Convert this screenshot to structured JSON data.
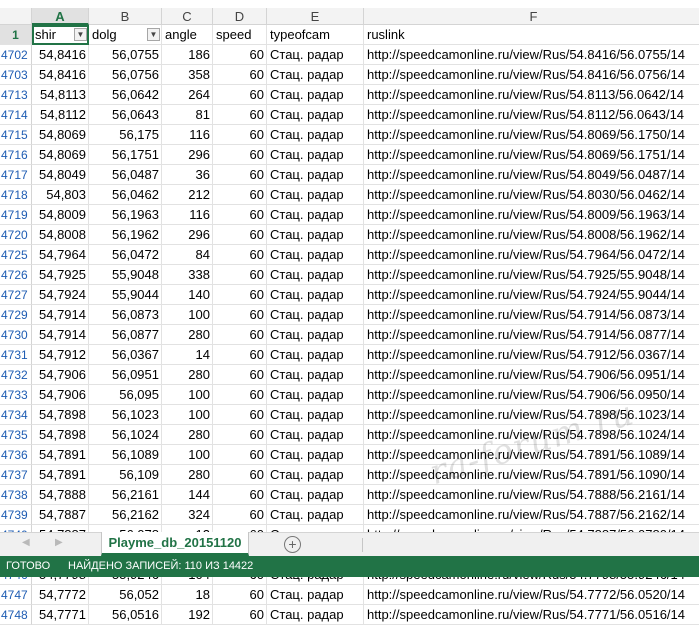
{
  "columns": [
    {
      "letter": "A",
      "selected": true
    },
    {
      "letter": "B",
      "selected": false
    },
    {
      "letter": "C",
      "selected": false
    },
    {
      "letter": "D",
      "selected": false
    },
    {
      "letter": "E",
      "selected": false
    },
    {
      "letter": "F",
      "selected": false
    }
  ],
  "header_row": {
    "row_number": "1",
    "cells": [
      "shir",
      "dolg",
      "angle",
      "speed",
      "typeofcam",
      "ruslink"
    ],
    "filter_icons": [
      "filter-active-icon",
      "filter-dropdown-icon"
    ]
  },
  "rows": [
    {
      "n": "4702",
      "cells": [
        "54,8416",
        "56,0755",
        "186",
        "60",
        "Стац. радар",
        "http://speedcamonline.ru/view/Rus/54.8416/56.0755/14"
      ]
    },
    {
      "n": "4703",
      "cells": [
        "54,8416",
        "56,0756",
        "358",
        "60",
        "Стац. радар",
        "http://speedcamonline.ru/view/Rus/54.8416/56.0756/14"
      ]
    },
    {
      "n": "4713",
      "cells": [
        "54,8113",
        "56,0642",
        "264",
        "60",
        "Стац. радар",
        "http://speedcamonline.ru/view/Rus/54.8113/56.0642/14"
      ]
    },
    {
      "n": "4714",
      "cells": [
        "54,8112",
        "56,0643",
        "81",
        "60",
        "Стац. радар",
        "http://speedcamonline.ru/view/Rus/54.8112/56.0643/14"
      ]
    },
    {
      "n": "4715",
      "cells": [
        "54,8069",
        "56,175",
        "116",
        "60",
        "Стац. радар",
        "http://speedcamonline.ru/view/Rus/54.8069/56.1750/14"
      ]
    },
    {
      "n": "4716",
      "cells": [
        "54,8069",
        "56,1751",
        "296",
        "60",
        "Стац. радар",
        "http://speedcamonline.ru/view/Rus/54.8069/56.1751/14"
      ]
    },
    {
      "n": "4717",
      "cells": [
        "54,8049",
        "56,0487",
        "36",
        "60",
        "Стац. радар",
        "http://speedcamonline.ru/view/Rus/54.8049/56.0487/14"
      ]
    },
    {
      "n": "4718",
      "cells": [
        "54,803",
        "56,0462",
        "212",
        "60",
        "Стац. радар",
        "http://speedcamonline.ru/view/Rus/54.8030/56.0462/14"
      ]
    },
    {
      "n": "4719",
      "cells": [
        "54,8009",
        "56,1963",
        "116",
        "60",
        "Стац. радар",
        "http://speedcamonline.ru/view/Rus/54.8009/56.1963/14"
      ]
    },
    {
      "n": "4720",
      "cells": [
        "54,8008",
        "56,1962",
        "296",
        "60",
        "Стац. радар",
        "http://speedcamonline.ru/view/Rus/54.8008/56.1962/14"
      ]
    },
    {
      "n": "4725",
      "cells": [
        "54,7964",
        "56,0472",
        "84",
        "60",
        "Стац. радар",
        "http://speedcamonline.ru/view/Rus/54.7964/56.0472/14"
      ]
    },
    {
      "n": "4726",
      "cells": [
        "54,7925",
        "55,9048",
        "338",
        "60",
        "Стац. радар",
        "http://speedcamonline.ru/view/Rus/54.7925/55.9048/14"
      ]
    },
    {
      "n": "4727",
      "cells": [
        "54,7924",
        "55,9044",
        "140",
        "60",
        "Стац. радар",
        "http://speedcamonline.ru/view/Rus/54.7924/55.9044/14"
      ]
    },
    {
      "n": "4729",
      "cells": [
        "54,7914",
        "56,0873",
        "100",
        "60",
        "Стац. радар",
        "http://speedcamonline.ru/view/Rus/54.7914/56.0873/14"
      ]
    },
    {
      "n": "4730",
      "cells": [
        "54,7914",
        "56,0877",
        "280",
        "60",
        "Стац. радар",
        "http://speedcamonline.ru/view/Rus/54.7914/56.0877/14"
      ]
    },
    {
      "n": "4731",
      "cells": [
        "54,7912",
        "56,0367",
        "14",
        "60",
        "Стац. радар",
        "http://speedcamonline.ru/view/Rus/54.7912/56.0367/14"
      ]
    },
    {
      "n": "4732",
      "cells": [
        "54,7906",
        "56,0951",
        "280",
        "60",
        "Стац. радар",
        "http://speedcamonline.ru/view/Rus/54.7906/56.0951/14"
      ]
    },
    {
      "n": "4733",
      "cells": [
        "54,7906",
        "56,095",
        "100",
        "60",
        "Стац. радар",
        "http://speedcamonline.ru/view/Rus/54.7906/56.0950/14"
      ]
    },
    {
      "n": "4734",
      "cells": [
        "54,7898",
        "56,1023",
        "100",
        "60",
        "Стац. радар",
        "http://speedcamonline.ru/view/Rus/54.7898/56.1023/14"
      ]
    },
    {
      "n": "4735",
      "cells": [
        "54,7898",
        "56,1024",
        "280",
        "60",
        "Стац. радар",
        "http://speedcamonline.ru/view/Rus/54.7898/56.1024/14"
      ]
    },
    {
      "n": "4736",
      "cells": [
        "54,7891",
        "56,1089",
        "100",
        "60",
        "Стац. радар",
        "http://speedcamonline.ru/view/Rus/54.7891/56.1089/14"
      ]
    },
    {
      "n": "4737",
      "cells": [
        "54,7891",
        "56,109",
        "280",
        "60",
        "Стац. радар",
        "http://speedcamonline.ru/view/Rus/54.7891/56.1090/14"
      ]
    },
    {
      "n": "4738",
      "cells": [
        "54,7888",
        "56,2161",
        "144",
        "60",
        "Стац. радар",
        "http://speedcamonline.ru/view/Rus/54.7888/56.2161/14"
      ]
    },
    {
      "n": "4739",
      "cells": [
        "54,7887",
        "56,2162",
        "324",
        "60",
        "Стац. радар",
        "http://speedcamonline.ru/view/Rus/54.7887/56.2162/14"
      ]
    },
    {
      "n": "4740",
      "cells": [
        "54,7887",
        "56,078",
        "12",
        "60",
        "Стац. радар",
        "http://speedcamonline.ru/view/Rus/54.7887/56.0780/14"
      ]
    },
    {
      "n": "4745",
      "cells": [
        "54,78",
        "55,9247",
        "280",
        "60",
        "Стац. радар",
        "http://speedcamonline.ru/view/Rus/54.7800/55.9247/14"
      ]
    },
    {
      "n": "4746",
      "cells": [
        "54,7798",
        "55,9246",
        "104",
        "60",
        "Стац. радар",
        "http://speedcamonline.ru/view/Rus/54.7798/55.9246/14"
      ]
    },
    {
      "n": "4747",
      "cells": [
        "54,7772",
        "56,052",
        "18",
        "60",
        "Стац. радар",
        "http://speedcamonline.ru/view/Rus/54.7772/56.0520/14"
      ]
    },
    {
      "n": "4748",
      "cells": [
        "54,7771",
        "56,0516",
        "192",
        "60",
        "Стац. радар",
        "http://speedcamonline.ru/view/Rus/54.7771/56.0516/14"
      ]
    }
  ],
  "tabs": {
    "nav_prev": "◀",
    "nav_next": "▶",
    "active_sheet": "Playme_db_20151120",
    "add_symbol": "+"
  },
  "status": {
    "ready": "ГОТОВО",
    "records": "НАЙДЕНО ЗАПИСЕЙ: 110 ИЗ 14422"
  },
  "watermark": "ra-forum.ru",
  "colors": {
    "accent": "#217346",
    "row_number": "#1e5cb3"
  }
}
